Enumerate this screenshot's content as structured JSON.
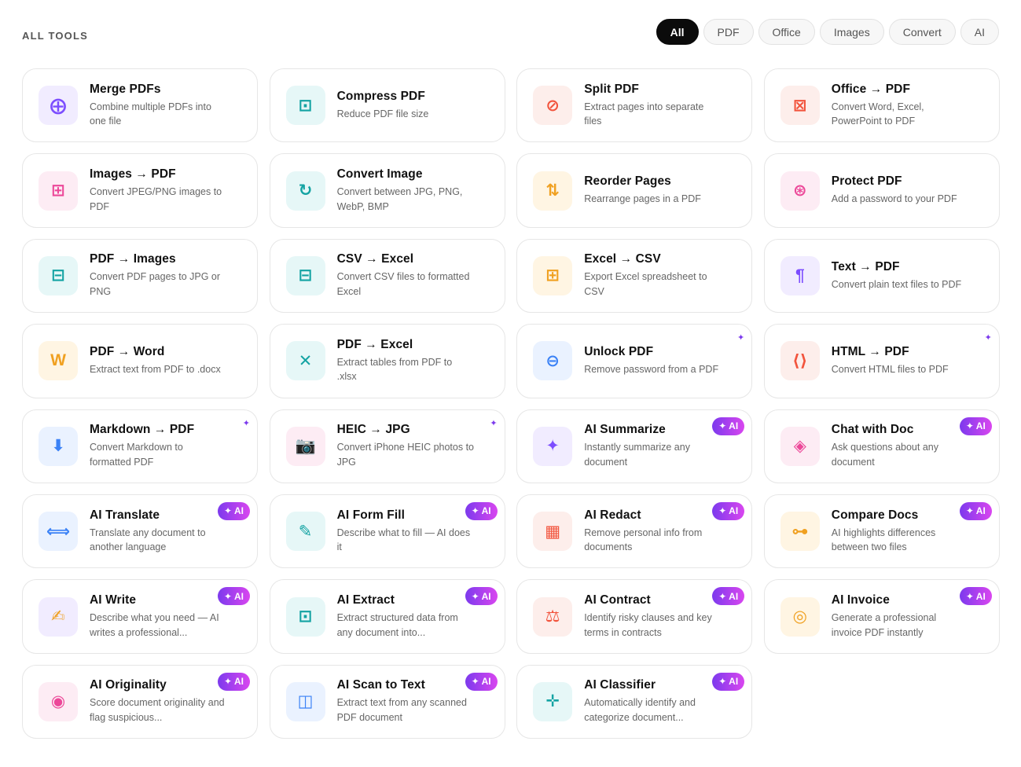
{
  "section_title": "ALL TOOLS",
  "filters": [
    "All",
    "PDF",
    "Office",
    "Images",
    "Convert",
    "AI"
  ],
  "active_filter": "All",
  "ai_badge_label": "✦ AI",
  "new_mark": "✦",
  "tools": [
    {
      "title": "Merge PDFs",
      "desc": "Combine multiple PDFs into one file",
      "icon": "⨁",
      "icon_name": "merge-icon",
      "icon_color": "#7c4dff",
      "icon_bg": "#f1ecff"
    },
    {
      "title": "Compress PDF",
      "desc": "Reduce PDF file size",
      "icon": "⊡",
      "icon_name": "compress-icon",
      "icon_color": "#14a3a3",
      "icon_bg": "#e6f7f7"
    },
    {
      "title": "Split PDF",
      "desc": "Extract pages into separate files",
      "icon": "⊘",
      "icon_name": "split-icon",
      "icon_color": "#f2543d",
      "icon_bg": "#fdeeeb"
    },
    {
      "title": "Office → PDF",
      "desc": "Convert Word, Excel, PowerPoint to PDF",
      "icon": "⊠",
      "icon_name": "office-icon",
      "icon_color": "#f2543d",
      "icon_bg": "#fdeeeb"
    },
    {
      "title": "Images → PDF",
      "desc": "Convert JPEG/PNG images to PDF",
      "icon": "⊞",
      "icon_name": "images-icon",
      "icon_color": "#ec4899",
      "icon_bg": "#fdecf4"
    },
    {
      "title": "Convert Image",
      "desc": "Convert between JPG, PNG, WebP, BMP",
      "icon": "↻",
      "icon_name": "refresh-icon",
      "icon_color": "#14a3a3",
      "icon_bg": "#e6f7f7"
    },
    {
      "title": "Reorder Pages",
      "desc": "Rearrange pages in a PDF",
      "icon": "⇅",
      "icon_name": "reorder-icon",
      "icon_color": "#f0a020",
      "icon_bg": "#fff5e3"
    },
    {
      "title": "Protect PDF",
      "desc": "Add a password to your PDF",
      "icon": "⊛",
      "icon_name": "lock-icon",
      "icon_color": "#ec4899",
      "icon_bg": "#fdecf4"
    },
    {
      "title": "PDF → Images",
      "desc": "Convert PDF pages to JPG or PNG",
      "icon": "⊟",
      "icon_name": "image-frame-icon",
      "icon_color": "#14a3a3",
      "icon_bg": "#e6f7f7"
    },
    {
      "title": "CSV → Excel",
      "desc": "Convert CSV files to formatted Excel",
      "icon": "⊟",
      "icon_name": "spreadsheet-icon",
      "icon_color": "#14a3a3",
      "icon_bg": "#e6f7f7"
    },
    {
      "title": "Excel → CSV",
      "desc": "Export Excel spreadsheet to CSV",
      "icon": "⊞",
      "icon_name": "table-icon",
      "icon_color": "#f0a020",
      "icon_bg": "#fff5e3"
    },
    {
      "title": "Text → PDF",
      "desc": "Convert plain text files to PDF",
      "icon": "¶",
      "icon_name": "text-icon",
      "icon_color": "#7c4dff",
      "icon_bg": "#f1ecff"
    },
    {
      "title": "PDF → Word",
      "desc": "Extract text from PDF to .docx",
      "icon": "W",
      "icon_name": "word-icon",
      "icon_color": "#f0a020",
      "icon_bg": "#fff5e3"
    },
    {
      "title": "PDF → Excel",
      "desc": "Extract tables from PDF to .xlsx",
      "icon": "✕",
      "icon_name": "excel-icon",
      "icon_color": "#14a3a3",
      "icon_bg": "#e6f7f7"
    },
    {
      "title": "Unlock PDF",
      "desc": "Remove password from a PDF",
      "icon": "⊖",
      "icon_name": "unlock-icon",
      "icon_color": "#3b82f6",
      "icon_bg": "#eaf2ff",
      "new": true
    },
    {
      "title": "HTML → PDF",
      "desc": "Convert HTML files to PDF",
      "icon": "⟨⟩",
      "icon_name": "code-icon",
      "icon_color": "#f2543d",
      "icon_bg": "#fdeeeb",
      "new": true
    },
    {
      "title": "Markdown → PDF",
      "desc": "Convert Markdown to formatted PDF",
      "icon": "⬇",
      "icon_name": "download-icon",
      "icon_color": "#3b82f6",
      "icon_bg": "#eaf2ff",
      "new": true
    },
    {
      "title": "HEIC → JPG",
      "desc": "Convert iPhone HEIC photos to JPG",
      "icon": "📷",
      "icon_name": "camera-icon",
      "icon_color": "#555555",
      "icon_bg": "#fdecf4",
      "new": true
    },
    {
      "title": "AI Summarize",
      "desc": "Instantly summarize any document",
      "icon": "✦",
      "icon_name": "sparkle-icon",
      "icon_color": "#7c4dff",
      "icon_bg": "#f1ecff",
      "ai": true
    },
    {
      "title": "Chat with Doc",
      "desc": "Ask questions about any document",
      "icon": "◈",
      "icon_name": "chat-icon",
      "icon_color": "#ec4899",
      "icon_bg": "#fdecf4",
      "ai": true
    },
    {
      "title": "AI Translate",
      "desc": "Translate any document to another language",
      "icon": "⟺",
      "icon_name": "translate-icon",
      "icon_color": "#3b82f6",
      "icon_bg": "#eaf2ff",
      "ai": true
    },
    {
      "title": "AI Form Fill",
      "desc": "Describe what to fill — AI does it",
      "icon": "✎",
      "icon_name": "pencil-icon",
      "icon_color": "#14a3a3",
      "icon_bg": "#e6f7f7",
      "ai": true
    },
    {
      "title": "AI Redact",
      "desc": "Remove personal info from documents",
      "icon": "▦",
      "icon_name": "redact-icon",
      "icon_color": "#f2543d",
      "icon_bg": "#fdeeeb",
      "ai": true
    },
    {
      "title": "Compare Docs",
      "desc": "AI highlights differences between two files",
      "icon": "⊶",
      "icon_name": "compare-icon",
      "icon_color": "#f0a020",
      "icon_bg": "#fff5e3",
      "ai": true
    },
    {
      "title": "AI Write",
      "desc": "Describe what you need — AI writes a professional...",
      "icon": "✍",
      "icon_name": "write-icon",
      "icon_color": "#f0a020",
      "icon_bg": "#f1ecff",
      "ai": true
    },
    {
      "title": "AI Extract",
      "desc": "Extract structured data from any document into...",
      "icon": "⊡",
      "icon_name": "extract-icon",
      "icon_color": "#14a3a3",
      "icon_bg": "#e6f7f7",
      "ai": true
    },
    {
      "title": "AI Contract",
      "desc": "Identify risky clauses and key terms in contracts",
      "icon": "⚖",
      "icon_name": "scales-icon",
      "icon_color": "#f2543d",
      "icon_bg": "#fdeeeb",
      "ai": true
    },
    {
      "title": "AI Invoice",
      "desc": "Generate a professional invoice PDF instantly",
      "icon": "◎",
      "icon_name": "invoice-icon",
      "icon_color": "#f0a020",
      "icon_bg": "#fff5e3",
      "ai": true
    },
    {
      "title": "AI Originality",
      "desc": "Score document originality and flag suspicious...",
      "icon": "◉",
      "icon_name": "target-icon",
      "icon_color": "#ec4899",
      "icon_bg": "#fdecf4",
      "ai": true
    },
    {
      "title": "AI Scan to Text",
      "desc": "Extract text from any scanned PDF document",
      "icon": "◫",
      "icon_name": "scan-icon",
      "icon_color": "#3b82f6",
      "icon_bg": "#eaf2ff",
      "ai": true
    },
    {
      "title": "AI Classifier",
      "desc": "Automatically identify and categorize document...",
      "icon": "✛",
      "icon_name": "classifier-icon",
      "icon_color": "#14a3a3",
      "icon_bg": "#e6f7f7",
      "ai": true
    }
  ]
}
